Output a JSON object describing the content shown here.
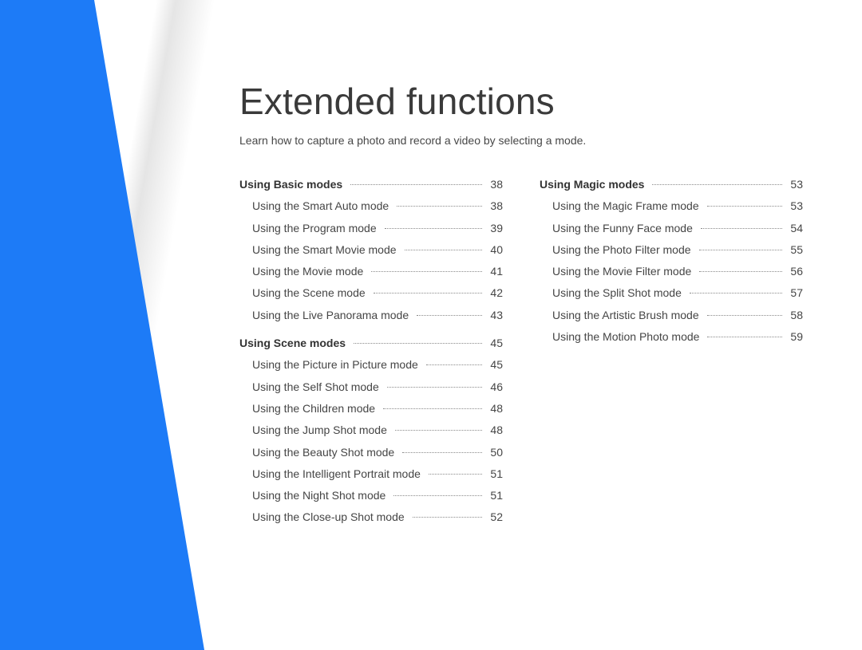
{
  "title": "Extended functions",
  "subtitle": "Learn how to capture a photo and record a video by selecting a mode.",
  "columns": [
    {
      "sections": [
        {
          "header": {
            "label": "Using Basic modes",
            "page": 38
          },
          "items": [
            {
              "label": "Using the Smart Auto mode",
              "page": 38
            },
            {
              "label": "Using the Program mode",
              "page": 39
            },
            {
              "label": "Using the Smart Movie mode",
              "page": 40
            },
            {
              "label": "Using the Movie mode",
              "page": 41
            },
            {
              "label": "Using the Scene mode",
              "page": 42
            },
            {
              "label": "Using the Live Panorama mode",
              "page": 43
            }
          ]
        },
        {
          "header": {
            "label": "Using Scene modes",
            "page": 45
          },
          "items": [
            {
              "label": "Using the Picture in Picture mode",
              "page": 45
            },
            {
              "label": "Using the Self Shot mode",
              "page": 46
            },
            {
              "label": "Using the Children mode",
              "page": 48
            },
            {
              "label": "Using the Jump Shot mode",
              "page": 48
            },
            {
              "label": "Using the Beauty Shot mode",
              "page": 50
            },
            {
              "label": "Using the Intelligent Portrait mode",
              "page": 51
            },
            {
              "label": "Using the Night Shot mode",
              "page": 51
            },
            {
              "label": "Using the Close-up Shot mode",
              "page": 52
            }
          ]
        }
      ]
    },
    {
      "sections": [
        {
          "header": {
            "label": "Using Magic modes",
            "page": 53
          },
          "items": [
            {
              "label": "Using the Magic Frame mode",
              "page": 53
            },
            {
              "label": "Using the Funny Face mode",
              "page": 54
            },
            {
              "label": "Using the Photo Filter mode",
              "page": 55
            },
            {
              "label": "Using the Movie Filter mode",
              "page": 56
            },
            {
              "label": "Using the Split Shot mode",
              "page": 57
            },
            {
              "label": "Using the Artistic Brush mode",
              "page": 58
            },
            {
              "label": "Using the Motion Photo mode",
              "page": 59
            }
          ]
        }
      ]
    }
  ]
}
